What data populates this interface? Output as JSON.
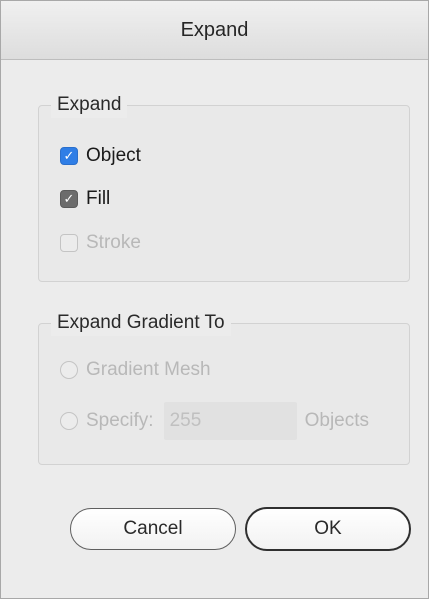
{
  "window": {
    "title": "Expand"
  },
  "expand_group": {
    "title": "Expand",
    "items": [
      {
        "label": "Object",
        "checked": true,
        "enabled": true,
        "style": "blue"
      },
      {
        "label": "Fill",
        "checked": true,
        "enabled": true,
        "style": "gray"
      },
      {
        "label": "Stroke",
        "checked": false,
        "enabled": false,
        "style": "off"
      }
    ]
  },
  "gradient_group": {
    "title": "Expand Gradient To",
    "options": [
      {
        "label": "Gradient Mesh",
        "enabled": false
      },
      {
        "label": "Specify:",
        "enabled": false
      }
    ],
    "specify_value": "255",
    "specify_unit": "Objects"
  },
  "buttons": {
    "cancel": "Cancel",
    "ok": "OK"
  },
  "icons": {
    "checkmark": "checkmark-icon",
    "radio": "radio-icon"
  },
  "colors": {
    "accent": "#2f7ee6",
    "disabled_text": "#b8b8b8"
  }
}
